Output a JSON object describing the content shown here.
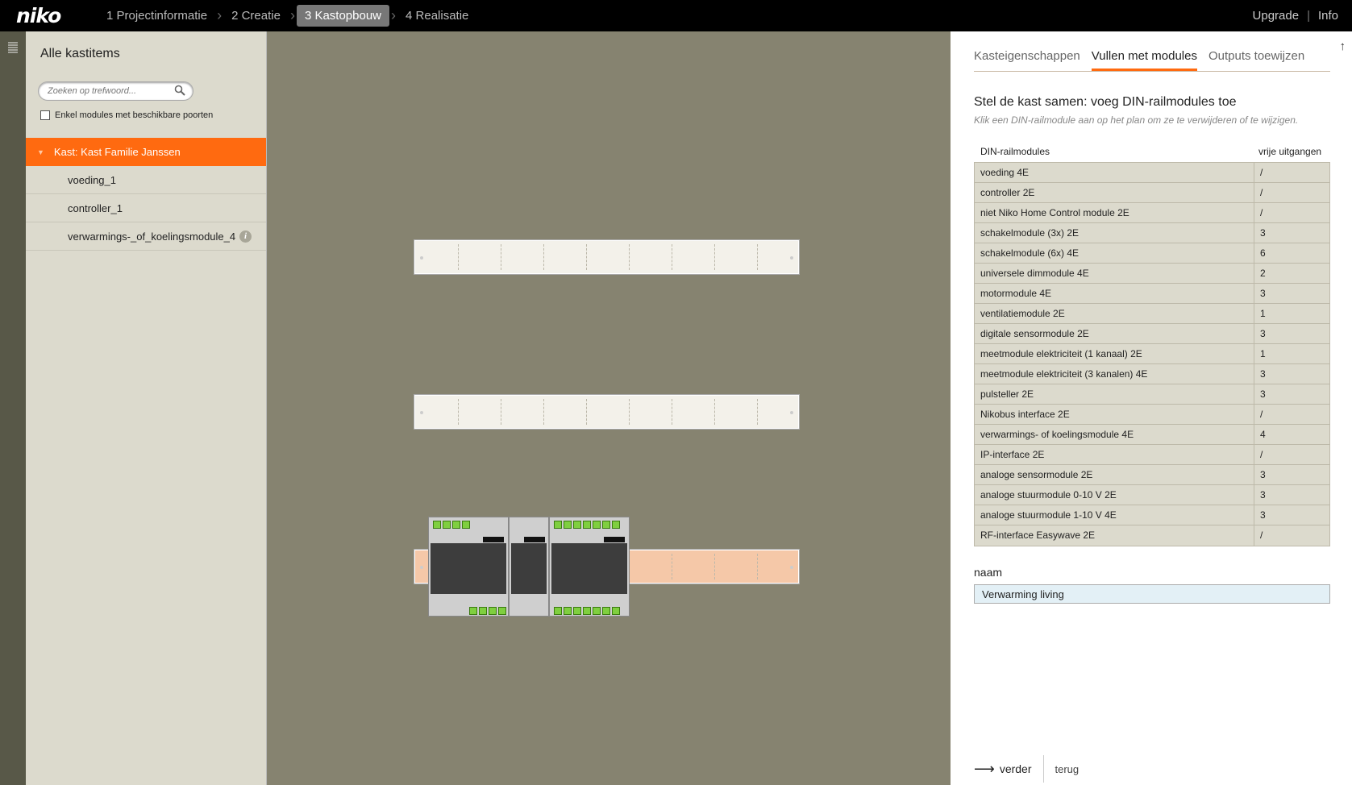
{
  "app": {
    "logo": "niko"
  },
  "steps": [
    {
      "label": "1 Projectinformatie",
      "active": false
    },
    {
      "label": "2 Creatie",
      "active": false
    },
    {
      "label": "3 Kastopbouw",
      "active": true
    },
    {
      "label": "4 Realisatie",
      "active": false
    }
  ],
  "toplinks": {
    "upgrade": "Upgrade",
    "separator": "|",
    "info": "Info"
  },
  "sidebar": {
    "title": "Alle kastitems",
    "search_placeholder": "Zoeken op trefwoord...",
    "filter_label": "Enkel modules met beschikbare poorten",
    "tree_root": "Kast: Kast Familie Janssen",
    "items": [
      {
        "label": "voeding_1",
        "info": false
      },
      {
        "label": "controller_1",
        "info": false
      },
      {
        "label": "verwarmings-_of_koelingsmodule_4",
        "info": true
      }
    ]
  },
  "panel": {
    "tabs": [
      {
        "label": "Kasteigenschappen",
        "active": false
      },
      {
        "label": "Vullen met modules",
        "active": true
      },
      {
        "label": "Outputs toewijzen",
        "active": false
      }
    ],
    "title": "Stel de kast samen: voeg DIN-railmodules toe",
    "subtitle": "Klik een DIN-railmodule aan op het plan om ze te verwijderen of te wijzigen.",
    "col_module": "DIN-railmodules",
    "col_outputs": "vrije uitgangen",
    "rows": [
      {
        "name": "voeding 4E",
        "outputs": "/"
      },
      {
        "name": "controller 2E",
        "outputs": "/"
      },
      {
        "name": "niet Niko Home Control module 2E",
        "outputs": "/"
      },
      {
        "name": "schakelmodule (3x) 2E",
        "outputs": "3"
      },
      {
        "name": "schakelmodule (6x) 4E",
        "outputs": "6"
      },
      {
        "name": "universele dimmodule 4E",
        "outputs": "2"
      },
      {
        "name": "motormodule 4E",
        "outputs": "3"
      },
      {
        "name": "ventilatiemodule 2E",
        "outputs": "1"
      },
      {
        "name": "digitale sensormodule 2E",
        "outputs": "3"
      },
      {
        "name": "meetmodule elektriciteit (1 kanaal) 2E",
        "outputs": "1"
      },
      {
        "name": "meetmodule elektriciteit (3 kanalen) 4E",
        "outputs": "3"
      },
      {
        "name": "pulsteller 2E",
        "outputs": "3"
      },
      {
        "name": "Nikobus interface 2E",
        "outputs": "/"
      },
      {
        "name": "verwarmings- of koelingsmodule 4E",
        "outputs": "4"
      },
      {
        "name": "IP-interface 2E",
        "outputs": "/"
      },
      {
        "name": "analoge sensormodule 2E",
        "outputs": "3"
      },
      {
        "name": "analoge stuurmodule 0-10 V 2E",
        "outputs": "3"
      },
      {
        "name": "analoge stuurmodule 1-10 V 4E",
        "outputs": "3"
      },
      {
        "name": "RF-interface Easywave 2E",
        "outputs": "/"
      }
    ],
    "naam_label": "naam",
    "naam_value": "Verwarming living",
    "next_label": "verder",
    "back_label": "terug"
  },
  "colors": {
    "accent": "#ff6a10",
    "canvas": "#868370",
    "sidebar": "#dcdacd"
  },
  "icons": {
    "menu": "menu-icon",
    "search": "search-icon",
    "info": "info-icon",
    "up": "arrow-up-icon",
    "next": "arrow-right-icon"
  }
}
